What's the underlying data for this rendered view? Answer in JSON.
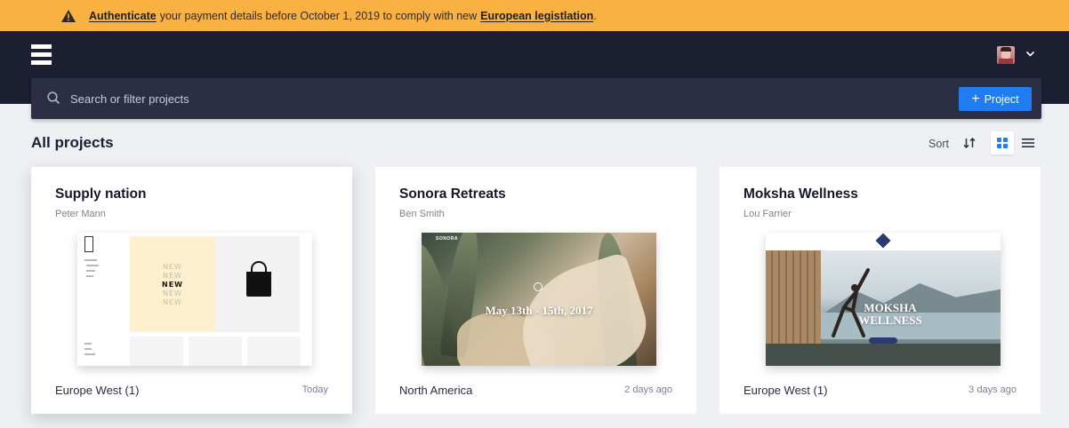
{
  "banner": {
    "link1": "Authenticate",
    "text": "your payment details before October 1, 2019 to comply with new",
    "link2": "European legistlation",
    "suffix": ".",
    "icon": "warning-icon"
  },
  "header": {
    "logo": "stacked-bars-logo",
    "avatar": "user-avatar",
    "menu_icon": "chevron-down-icon"
  },
  "search": {
    "placeholder": "Search or filter projects",
    "button_label": "Project"
  },
  "toolbar": {
    "title": "All projects",
    "sort_label": "Sort",
    "view": "grid"
  },
  "colors": {
    "banner": "#f9b141",
    "header": "#1c1e31",
    "primary": "#1f7cf1"
  },
  "projects": [
    {
      "title": "Supply nation",
      "owner": "Peter Mann",
      "region": "Europe West (1)",
      "updated": "Today",
      "thumb_text": [
        "NEW",
        "NEW",
        "NEW",
        "NEW",
        "NEW"
      ]
    },
    {
      "title": "Sonora Retreats",
      "owner": "Ben Smith",
      "region": "North America",
      "updated": "2 days ago",
      "thumb_brand": "SONORA",
      "thumb_text": "May 13th - 15th, 2017"
    },
    {
      "title": "Moksha Wellness",
      "owner": "Lou Farrier",
      "region": "Europe West (1)",
      "updated": "3 days ago",
      "thumb_text1": "MOKSHA",
      "thumb_text2": "WELLNESS"
    }
  ]
}
